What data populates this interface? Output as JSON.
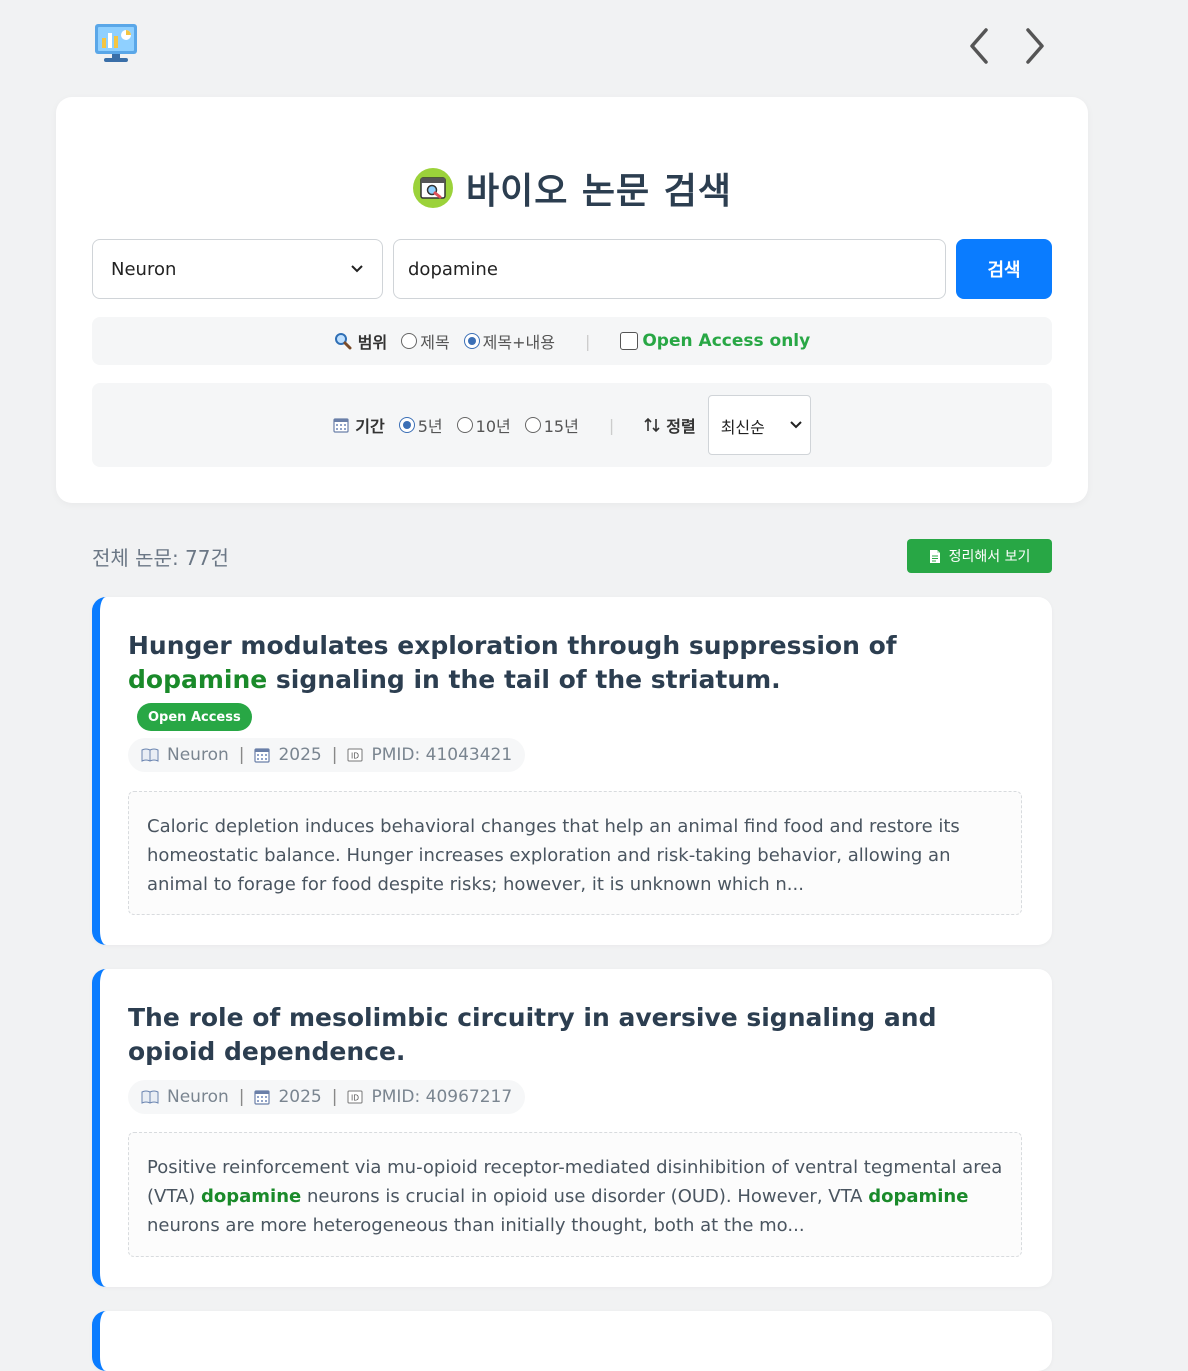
{
  "header": {
    "app_icon": "monitor-dashboard-icon",
    "prev_icon": "chevron-left-icon",
    "next_icon": "chevron-right-icon"
  },
  "search": {
    "title": "바이오 논문 검색",
    "title_icon": "search-browser-icon",
    "journal_selected": "Neuron",
    "query_value": "dopamine",
    "button_label": "검색"
  },
  "scope": {
    "label": "범위",
    "icon": "magnifier-icon",
    "options": [
      "제목",
      "제목+내용"
    ],
    "selected": "제목+내용",
    "open_access_label": "Open Access only",
    "open_access_checked": false
  },
  "period": {
    "label": "기간",
    "icon": "calendar-icon",
    "options": [
      "5년",
      "10년",
      "15년"
    ],
    "selected": "5년",
    "sort_label": "정렬",
    "sort_icon": "sort-arrows-icon",
    "sort_selected": "최신순"
  },
  "results": {
    "total_label": "전체 논문: 77건",
    "summary_button_label": "정리해서 보기",
    "summary_icon": "document-icon"
  },
  "papers": [
    {
      "title_parts": [
        "Hunger modulates exploration through suppression of ",
        "dopamine",
        " signaling in the tail of the striatum."
      ],
      "open_access_badge": "Open Access",
      "journal": "Neuron",
      "year": "2025",
      "pmid": "PMID: 41043421",
      "abstract_parts": [
        "Caloric depletion induces behavioral changes that help an animal find food and restore its homeostatic balance. Hunger increases exploration and risk-taking behavior, allowing an animal to forage for food despite risks; however, it is unknown which n..."
      ]
    },
    {
      "title_parts": [
        "The role of mesolimbic circuitry in aversive signaling and opioid dependence."
      ],
      "journal": "Neuron",
      "year": "2025",
      "pmid": "PMID: 40967217",
      "abstract_parts": [
        "Positive reinforcement via mu-opioid receptor-mediated disinhibition of ventral tegmental area (VTA) ",
        "dopamine",
        " neurons is crucial in opioid use disorder (OUD). However, VTA ",
        "dopamine",
        " neurons are more heterogeneous than initially thought, both at the mo..."
      ]
    }
  ],
  "colors": {
    "accent": "#0a7cff",
    "open_access": "#28a745",
    "highlight": "#1a8a2a",
    "background": "#f1f2f3"
  }
}
